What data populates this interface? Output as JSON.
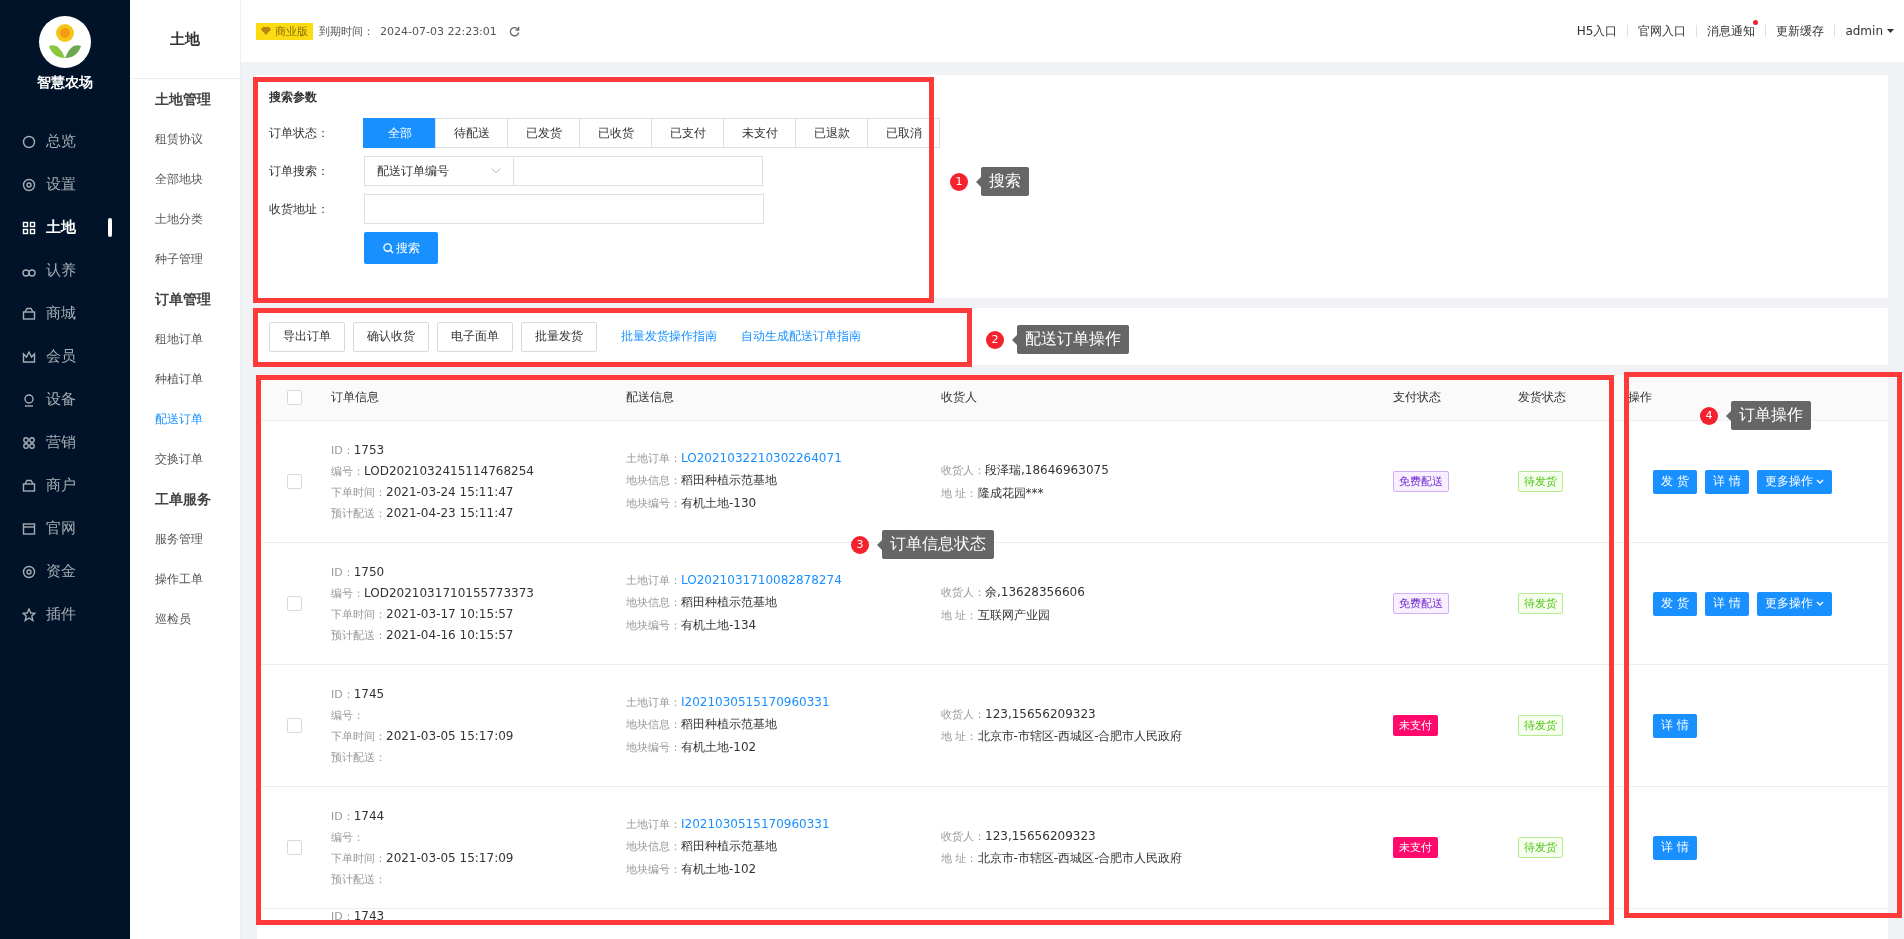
{
  "app": {
    "logo_text": "智慧农场"
  },
  "nav": [
    {
      "label": "总览",
      "selected": false
    },
    {
      "label": "设置",
      "selected": false
    },
    {
      "label": "土地",
      "selected": true
    },
    {
      "label": "认养",
      "selected": false
    },
    {
      "label": "商城",
      "selected": false
    },
    {
      "label": "会员",
      "selected": false
    },
    {
      "label": "设备",
      "selected": false
    },
    {
      "label": "营销",
      "selected": false
    },
    {
      "label": "商户",
      "selected": false
    },
    {
      "label": "官网",
      "selected": false
    },
    {
      "label": "资金",
      "selected": false
    },
    {
      "label": "插件",
      "selected": false
    }
  ],
  "subnav": {
    "title": "土地",
    "groups": [
      {
        "title": "土地管理",
        "items": [
          {
            "label": "租赁协议",
            "selected": false
          },
          {
            "label": "全部地块",
            "selected": false
          },
          {
            "label": "土地分类",
            "selected": false
          },
          {
            "label": "种子管理",
            "selected": false
          }
        ]
      },
      {
        "title": "订单管理",
        "items": [
          {
            "label": "租地订单",
            "selected": false
          },
          {
            "label": "种植订单",
            "selected": false
          },
          {
            "label": "配送订单",
            "selected": true
          },
          {
            "label": "交换订单",
            "selected": false
          }
        ]
      },
      {
        "title": "工单服务",
        "items": [
          {
            "label": "服务管理",
            "selected": false
          },
          {
            "label": "操作工单",
            "selected": false
          },
          {
            "label": "巡检员",
            "selected": false
          }
        ]
      }
    ]
  },
  "topbar": {
    "edition": "商业版",
    "expiry_label": "到期时间：",
    "expiry": "2024-07-03 22:23:01",
    "links": [
      {
        "label": "H5入口",
        "notification": false
      },
      {
        "label": "官网入口",
        "notification": false
      },
      {
        "label": "消息通知",
        "notification": true
      },
      {
        "label": "更新缓存",
        "notification": false
      }
    ],
    "user": "admin"
  },
  "search": {
    "title": "搜索参数",
    "status_label": "订单状态：",
    "statuses": [
      {
        "label": "全部",
        "selected": true
      },
      {
        "label": "待配送",
        "selected": false
      },
      {
        "label": "已发货",
        "selected": false
      },
      {
        "label": "已收货",
        "selected": false
      },
      {
        "label": "已支付",
        "selected": false
      },
      {
        "label": "未支付",
        "selected": false
      },
      {
        "label": "已退款",
        "selected": false
      },
      {
        "label": "已取消",
        "selected": false
      }
    ],
    "order_search_label": "订单搜索：",
    "order_search_type": "配送订单编号",
    "address_label": "收货地址：",
    "button": "搜索"
  },
  "toolbar": {
    "buttons": [
      "导出订单",
      "确认收货",
      "电子面单",
      "批量发货"
    ],
    "links": [
      "批量发货操作指南",
      "自动生成配送订单指南"
    ]
  },
  "table": {
    "columns": [
      "订单信息",
      "配送信息",
      "收货人",
      "支付状态",
      "发货状态",
      "操作"
    ],
    "header_checked": false,
    "rows": [
      {
        "checked": false,
        "order_info": [
          {
            "label": "ID：",
            "value": "1753"
          },
          {
            "label": "编号：",
            "value": "LOD2021032415114768254"
          },
          {
            "label": "下单时间：",
            "value": "2021-03-24 15:11:47"
          },
          {
            "label": "预计配送：",
            "value": "2021-04-23 15:11:47"
          }
        ],
        "delivery_info": [
          {
            "label": "土地订单：",
            "value": "LO2021032210302264071",
            "kind": "link"
          },
          {
            "label": "地块信息：",
            "value": "稻田种植示范基地",
            "kind": "text"
          },
          {
            "label": "地块编号：",
            "value": "有机土地-130",
            "kind": "text"
          }
        ],
        "receiver": [
          {
            "label": "收货人：",
            "value": "段泽瑞,18646963075"
          },
          {
            "label": "地 址：",
            "value": "隆成花园***"
          }
        ],
        "pay_status": {
          "text": "免费配送",
          "kind": "free"
        },
        "ship_status": "待发货",
        "actions": [
          {
            "label": "发 货",
            "dropdown": false
          },
          {
            "label": "详 情",
            "dropdown": false
          },
          {
            "label": "更多操作",
            "dropdown": true
          }
        ]
      },
      {
        "checked": false,
        "order_info": [
          {
            "label": "ID：",
            "value": "1750"
          },
          {
            "label": "编号：",
            "value": "LOD2021031710155773373"
          },
          {
            "label": "下单时间：",
            "value": "2021-03-17 10:15:57"
          },
          {
            "label": "预计配送：",
            "value": "2021-04-16 10:15:57"
          }
        ],
        "delivery_info": [
          {
            "label": "土地订单：",
            "value": "LO2021031710082878274",
            "kind": "link"
          },
          {
            "label": "地块信息：",
            "value": "稻田种植示范基地",
            "kind": "text"
          },
          {
            "label": "地块编号：",
            "value": "有机土地-134",
            "kind": "text"
          }
        ],
        "receiver": [
          {
            "label": "收货人：",
            "value": "余,13628356606"
          },
          {
            "label": "地 址：",
            "value": "互联网产业园"
          }
        ],
        "pay_status": {
          "text": "免费配送",
          "kind": "free"
        },
        "ship_status": "待发货",
        "actions": [
          {
            "label": "发 货",
            "dropdown": false
          },
          {
            "label": "详 情",
            "dropdown": false
          },
          {
            "label": "更多操作",
            "dropdown": true
          }
        ]
      },
      {
        "checked": false,
        "order_info": [
          {
            "label": "ID：",
            "value": "1745"
          },
          {
            "label": "编号："
          },
          {
            "label": "下单时间：",
            "value": "2021-03-05 15:17:09"
          },
          {
            "label": "预计配送："
          }
        ],
        "delivery_info": [
          {
            "label": "土地订单：",
            "value": "I2021030515170960331",
            "kind": "link"
          },
          {
            "label": "地块信息：",
            "value": "稻田种植示范基地",
            "kind": "text"
          },
          {
            "label": "地块编号：",
            "value": "有机土地-102",
            "kind": "text"
          }
        ],
        "receiver": [
          {
            "label": "收货人：",
            "value": "123,15656209323"
          },
          {
            "label": "地 址：",
            "value": "北京市-市辖区-西城区-合肥市人民政府"
          }
        ],
        "pay_status": {
          "text": "未支付",
          "kind": "unpaid"
        },
        "ship_status": "待发货",
        "actions": [
          {
            "label": "详 情",
            "dropdown": false
          }
        ]
      },
      {
        "checked": false,
        "order_info": [
          {
            "label": "ID：",
            "value": "1744"
          },
          {
            "label": "编号："
          },
          {
            "label": "下单时间：",
            "value": "2021-03-05 15:17:09"
          },
          {
            "label": "预计配送："
          }
        ],
        "delivery_info": [
          {
            "label": "土地订单：",
            "value": "I2021030515170960331",
            "kind": "link"
          },
          {
            "label": "地块信息：",
            "value": "稻田种植示范基地",
            "kind": "text"
          },
          {
            "label": "地块编号：",
            "value": "有机土地-102",
            "kind": "text"
          }
        ],
        "receiver": [
          {
            "label": "收货人：",
            "value": "123,15656209323"
          },
          {
            "label": "地 址：",
            "value": "北京市-市辖区-西城区-合肥市人民政府"
          }
        ],
        "pay_status": {
          "text": "未支付",
          "kind": "unpaid"
        },
        "ship_status": "待发货",
        "actions": [
          {
            "label": "详 情",
            "dropdown": false
          }
        ]
      },
      {
        "order_info": [
          {
            "label": "ID：",
            "value": "1743"
          }
        ]
      }
    ]
  },
  "annotations": [
    {
      "number": "1",
      "label": "搜索"
    },
    {
      "number": "2",
      "label": "配送订单操作"
    },
    {
      "number": "3",
      "label": "订单信息状态"
    },
    {
      "number": "4",
      "label": "订单操作"
    }
  ]
}
